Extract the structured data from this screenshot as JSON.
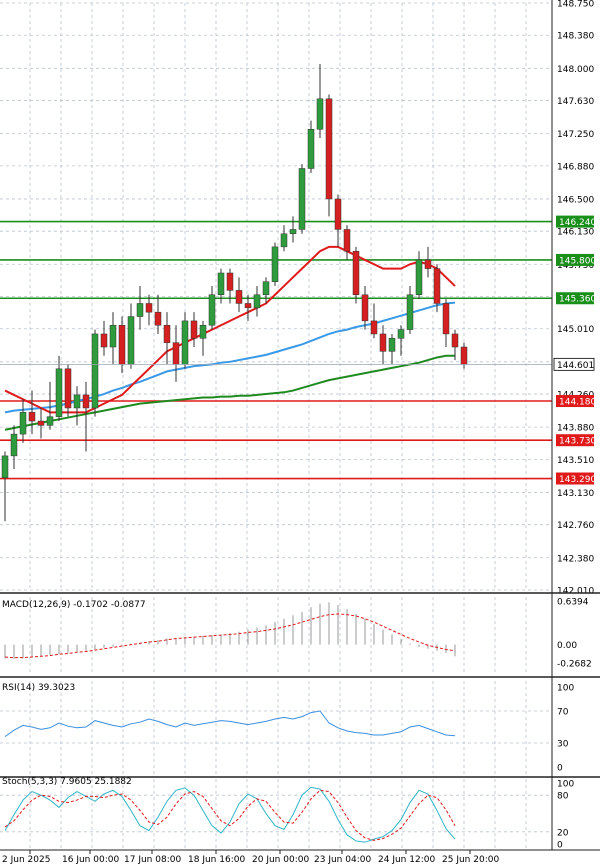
{
  "chart_data": [
    {
      "type": "candlestick",
      "panel": "price",
      "y_ticks": [
        "148.750",
        "148.380",
        "148.000",
        "147.630",
        "147.250",
        "146.880",
        "146.500",
        "146.130",
        "145.750",
        "145.380",
        "145.010",
        "144.630",
        "144.260",
        "143.880",
        "143.510",
        "143.130",
        "142.760",
        "142.380",
        "142.010"
      ],
      "ylim": [
        142.01,
        148.75
      ],
      "colors": {
        "up": "#2e9c3c",
        "down": "#d42020",
        "ma_fast": "#e01a1a",
        "ma_mid": "#3a9ae8",
        "ma_slow": "#1f8a1f",
        "support": "#e01a1a",
        "resistance": "#1a8f1a"
      },
      "current_price": "144.601",
      "resistance_levels": [
        "146.240",
        "145.800",
        "145.360"
      ],
      "support_levels": [
        "144.180",
        "143.730",
        "143.290"
      ],
      "candles": [
        {
          "o": 143.3,
          "h": 143.6,
          "l": 142.8,
          "c": 143.55
        },
        {
          "o": 143.55,
          "h": 143.9,
          "l": 143.4,
          "c": 143.8
        },
        {
          "o": 143.8,
          "h": 144.2,
          "l": 143.7,
          "c": 144.05
        },
        {
          "o": 144.05,
          "h": 144.3,
          "l": 143.8,
          "c": 143.95
        },
        {
          "o": 143.95,
          "h": 144.1,
          "l": 143.75,
          "c": 143.9
        },
        {
          "o": 143.9,
          "h": 144.4,
          "l": 143.85,
          "c": 144.0
        },
        {
          "o": 144.0,
          "h": 144.7,
          "l": 143.95,
          "c": 144.55
        },
        {
          "o": 144.55,
          "h": 144.6,
          "l": 144.0,
          "c": 144.1
        },
        {
          "o": 144.1,
          "h": 144.35,
          "l": 143.9,
          "c": 144.25
        },
        {
          "o": 144.25,
          "h": 144.4,
          "l": 143.6,
          "c": 144.1
        },
        {
          "o": 144.1,
          "h": 145.0,
          "l": 144.0,
          "c": 144.95
        },
        {
          "o": 144.95,
          "h": 145.1,
          "l": 144.7,
          "c": 144.8
        },
        {
          "o": 144.8,
          "h": 145.2,
          "l": 144.6,
          "c": 145.05
        },
        {
          "o": 145.05,
          "h": 145.15,
          "l": 144.5,
          "c": 144.6
        },
        {
          "o": 144.6,
          "h": 145.3,
          "l": 144.55,
          "c": 145.15
        },
        {
          "o": 145.15,
          "h": 145.5,
          "l": 145.0,
          "c": 145.3
        },
        {
          "o": 145.3,
          "h": 145.4,
          "l": 145.05,
          "c": 145.2
        },
        {
          "o": 145.2,
          "h": 145.4,
          "l": 144.95,
          "c": 145.05
        },
        {
          "o": 145.05,
          "h": 145.2,
          "l": 144.6,
          "c": 144.85
        },
        {
          "o": 144.85,
          "h": 145.05,
          "l": 144.4,
          "c": 144.6
        },
        {
          "o": 144.6,
          "h": 145.2,
          "l": 144.55,
          "c": 145.1
        },
        {
          "o": 145.1,
          "h": 145.2,
          "l": 144.8,
          "c": 144.9
        },
        {
          "o": 144.9,
          "h": 145.1,
          "l": 144.7,
          "c": 145.05
        },
        {
          "o": 145.05,
          "h": 145.5,
          "l": 145.0,
          "c": 145.4
        },
        {
          "o": 145.4,
          "h": 145.7,
          "l": 145.3,
          "c": 145.65
        },
        {
          "o": 145.65,
          "h": 145.7,
          "l": 145.3,
          "c": 145.45
        },
        {
          "o": 145.45,
          "h": 145.6,
          "l": 145.2,
          "c": 145.3
        },
        {
          "o": 145.3,
          "h": 145.4,
          "l": 145.1,
          "c": 145.25
        },
        {
          "o": 145.25,
          "h": 145.5,
          "l": 145.15,
          "c": 145.4
        },
        {
          "o": 145.4,
          "h": 145.6,
          "l": 145.3,
          "c": 145.55
        },
        {
          "o": 145.55,
          "h": 146.0,
          "l": 145.5,
          "c": 145.95
        },
        {
          "o": 145.95,
          "h": 146.2,
          "l": 145.9,
          "c": 146.1
        },
        {
          "o": 146.1,
          "h": 146.3,
          "l": 146.0,
          "c": 146.15
        },
        {
          "o": 146.15,
          "h": 146.9,
          "l": 146.1,
          "c": 146.85
        },
        {
          "o": 146.85,
          "h": 147.4,
          "l": 146.8,
          "c": 147.3
        },
        {
          "o": 147.3,
          "h": 148.05,
          "l": 147.2,
          "c": 147.65
        },
        {
          "o": 147.65,
          "h": 147.7,
          "l": 146.3,
          "c": 146.5
        },
        {
          "o": 146.5,
          "h": 146.55,
          "l": 145.95,
          "c": 146.15
        },
        {
          "o": 146.15,
          "h": 146.2,
          "l": 145.8,
          "c": 145.9
        },
        {
          "o": 145.9,
          "h": 145.95,
          "l": 145.3,
          "c": 145.4
        },
        {
          "o": 145.4,
          "h": 145.5,
          "l": 145.0,
          "c": 145.1
        },
        {
          "o": 145.1,
          "h": 145.3,
          "l": 144.9,
          "c": 144.95
        },
        {
          "o": 144.95,
          "h": 145.05,
          "l": 144.6,
          "c": 144.75
        },
        {
          "o": 144.75,
          "h": 144.95,
          "l": 144.6,
          "c": 144.9
        },
        {
          "o": 144.9,
          "h": 145.05,
          "l": 144.7,
          "c": 145.0
        },
        {
          "o": 145.0,
          "h": 145.5,
          "l": 144.95,
          "c": 145.4
        },
        {
          "o": 145.4,
          "h": 145.9,
          "l": 145.35,
          "c": 145.8
        },
        {
          "o": 145.8,
          "h": 145.95,
          "l": 145.6,
          "c": 145.7
        },
        {
          "o": 145.7,
          "h": 145.75,
          "l": 145.2,
          "c": 145.3
        },
        {
          "o": 145.3,
          "h": 145.35,
          "l": 144.8,
          "c": 144.95
        },
        {
          "o": 144.95,
          "h": 145.0,
          "l": 144.65,
          "c": 144.8
        },
        {
          "o": 144.8,
          "h": 144.85,
          "l": 144.55,
          "c": 144.6
        }
      ],
      "ma_fast": [
        144.3,
        144.25,
        144.2,
        144.15,
        144.1,
        144.05,
        144.05,
        144.05,
        144.05,
        144.05,
        144.1,
        144.15,
        144.2,
        144.25,
        144.35,
        144.45,
        144.55,
        144.65,
        144.75,
        144.8,
        144.85,
        144.9,
        144.95,
        145.0,
        145.05,
        145.1,
        145.15,
        145.2,
        145.25,
        145.3,
        145.4,
        145.5,
        145.6,
        145.7,
        145.8,
        145.9,
        145.95,
        145.95,
        145.9,
        145.85,
        145.8,
        145.75,
        145.7,
        145.7,
        145.7,
        145.75,
        145.78,
        145.75,
        145.7,
        145.6,
        145.5,
        null
      ],
      "ma_mid": [
        144.05,
        144.07,
        144.08,
        144.09,
        144.1,
        144.11,
        144.13,
        144.15,
        144.18,
        144.2,
        144.23,
        144.26,
        144.3,
        144.33,
        144.37,
        144.4,
        144.44,
        144.48,
        144.52,
        144.54,
        144.56,
        144.58,
        144.59,
        144.6,
        144.62,
        144.63,
        144.65,
        144.67,
        144.69,
        144.71,
        144.74,
        144.77,
        144.8,
        144.83,
        144.87,
        144.91,
        144.95,
        144.98,
        145.0,
        145.03,
        145.05,
        145.07,
        145.1,
        145.13,
        145.16,
        145.19,
        145.22,
        145.25,
        145.28,
        145.3,
        145.31,
        null
      ],
      "ma_slow": [
        143.85,
        143.87,
        143.89,
        143.91,
        143.93,
        143.95,
        143.97,
        143.99,
        144.01,
        144.03,
        144.05,
        144.07,
        144.09,
        144.11,
        144.13,
        144.15,
        144.16,
        144.17,
        144.18,
        144.19,
        144.2,
        144.21,
        144.22,
        144.22,
        144.23,
        144.23,
        144.24,
        144.24,
        144.25,
        144.26,
        144.27,
        144.28,
        144.3,
        144.33,
        144.36,
        144.39,
        144.42,
        144.44,
        144.46,
        144.48,
        144.5,
        144.52,
        144.54,
        144.56,
        144.58,
        144.6,
        144.62,
        144.65,
        144.68,
        144.7,
        144.7,
        null
      ]
    },
    {
      "type": "bar",
      "panel": "macd",
      "label": "MACD(12,26,9) -0.1702 -0.0877",
      "y_ticks": [
        "0.6394",
        "0.00",
        "-0.2682"
      ],
      "ylim": [
        -0.2682,
        0.6394
      ],
      "histogram": [
        -0.2,
        -0.21,
        -0.2,
        -0.18,
        -0.17,
        -0.15,
        -0.14,
        -0.12,
        -0.1,
        -0.09,
        -0.07,
        -0.05,
        -0.03,
        -0.01,
        0.01,
        0.03,
        0.05,
        0.07,
        0.09,
        0.1,
        0.11,
        0.12,
        0.13,
        0.14,
        0.15,
        0.17,
        0.19,
        0.22,
        0.25,
        0.28,
        0.33,
        0.38,
        0.43,
        0.48,
        0.55,
        0.6,
        0.62,
        0.58,
        0.52,
        0.45,
        0.38,
        0.3,
        0.22,
        0.15,
        0.08,
        0.02,
        -0.03,
        -0.06,
        -0.09,
        -0.12,
        -0.17
      ],
      "signal": [
        -0.18,
        -0.19,
        -0.19,
        -0.18,
        -0.17,
        -0.16,
        -0.14,
        -0.13,
        -0.11,
        -0.1,
        -0.08,
        -0.06,
        -0.04,
        -0.02,
        0.0,
        0.02,
        0.04,
        0.05,
        0.07,
        0.09,
        0.1,
        0.11,
        0.12,
        0.13,
        0.14,
        0.15,
        0.16,
        0.18,
        0.19,
        0.21,
        0.23,
        0.26,
        0.29,
        0.33,
        0.37,
        0.41,
        0.44,
        0.45,
        0.44,
        0.42,
        0.38,
        0.33,
        0.27,
        0.21,
        0.15,
        0.09,
        0.04,
        -0.01,
        -0.04,
        -0.07,
        -0.09
      ]
    },
    {
      "type": "line",
      "panel": "rsi",
      "label": "RSI(14) 39.3023",
      "y_ticks": [
        "100",
        "70",
        "30",
        "0"
      ],
      "ylim": [
        0,
        100
      ],
      "values": [
        38,
        46,
        52,
        50,
        47,
        49,
        55,
        51,
        49,
        50,
        58,
        55,
        52,
        50,
        54,
        56,
        60,
        57,
        53,
        50,
        55,
        52,
        54,
        56,
        58,
        57,
        55,
        53,
        55,
        57,
        60,
        62,
        60,
        63,
        68,
        70,
        55,
        49,
        45,
        43,
        42,
        40,
        40,
        42,
        44,
        50,
        52,
        48,
        44,
        40,
        39
      ]
    },
    {
      "type": "line",
      "panel": "stoch",
      "label": "Stoch(5,3,3) 7.9605 25.1882",
      "y_ticks": [
        "100",
        "80",
        "20",
        "0"
      ],
      "ylim": [
        0,
        100
      ],
      "k": [
        22,
        48,
        72,
        86,
        80,
        72,
        60,
        76,
        86,
        78,
        70,
        82,
        88,
        78,
        55,
        30,
        22,
        44,
        70,
        88,
        92,
        80,
        55,
        30,
        18,
        36,
        66,
        82,
        74,
        50,
        30,
        24,
        48,
        80,
        93,
        90,
        70,
        40,
        15,
        5,
        3,
        8,
        12,
        22,
        40,
        68,
        88,
        82,
        55,
        25,
        8
      ],
      "d": [
        28,
        38,
        56,
        72,
        80,
        78,
        70,
        68,
        72,
        78,
        78,
        76,
        80,
        82,
        72,
        55,
        36,
        32,
        44,
        66,
        82,
        86,
        78,
        58,
        38,
        30,
        42,
        62,
        74,
        70,
        52,
        36,
        34,
        52,
        74,
        88,
        86,
        68,
        44,
        22,
        10,
        6,
        9,
        16,
        26,
        46,
        66,
        80,
        76,
        56,
        30
      ]
    }
  ],
  "x_axis": {
    "labels": [
      "2 Jun 2025",
      "16 Jun 00:00",
      "17 Jun 08:00",
      "18 Jun 16:00",
      "20 Jun 00:00",
      "23 Jun 04:00",
      "24 Jun 12:00",
      "25 Jun 20:00"
    ]
  }
}
